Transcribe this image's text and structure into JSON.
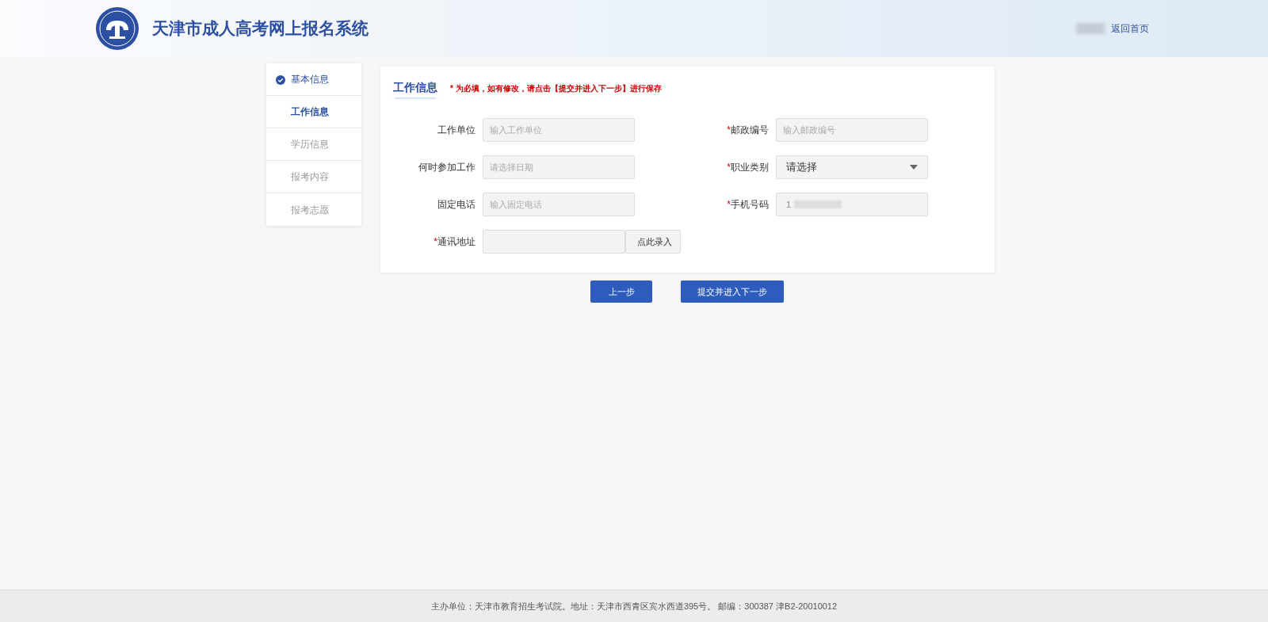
{
  "header": {
    "title": "天津市成人高考网上报名系统",
    "home_link": "返回首页"
  },
  "steps": [
    {
      "label": "基本信息",
      "completed": true,
      "selected": false,
      "disabled": false
    },
    {
      "label": "工作信息",
      "completed": false,
      "selected": true,
      "disabled": false
    },
    {
      "label": "学历信息",
      "completed": false,
      "selected": false,
      "disabled": true
    },
    {
      "label": "报考内容",
      "completed": false,
      "selected": false,
      "disabled": true
    },
    {
      "label": "报考志愿",
      "completed": false,
      "selected": false,
      "disabled": true
    }
  ],
  "form": {
    "title": "工作信息",
    "notice": "* 为必填，如有修改，请点击【提交并进入下一步】进行保存",
    "fields": [
      {
        "kind": "text",
        "label": "工作单位",
        "placeholder": "输入工作单位"
      },
      {
        "kind": "text",
        "label": "邮政编号",
        "required_mark": "*",
        "placeholder": "输入邮政编号"
      },
      {
        "kind": "text",
        "label": "何时参加工作",
        "placeholder": "请选择日期"
      },
      {
        "kind": "select",
        "label": "职业类别",
        "required_mark": "*",
        "value": "请选择"
      },
      {
        "kind": "text",
        "label": "固定电话",
        "placeholder": "输入固定电话"
      },
      {
        "kind": "masked",
        "label": "手机号码",
        "required_mark": "*",
        "value": "1"
      },
      {
        "kind": "address",
        "label": "通讯地址",
        "required_mark": "*",
        "button": "点此录入"
      }
    ]
  },
  "buttons": [
    "上一步",
    "提交并进入下一步"
  ],
  "footer": "主办单位：天津市教育招生考试院。地址：天津市西青区宾水西道395号。 邮编：300387 津B2-20010012"
}
